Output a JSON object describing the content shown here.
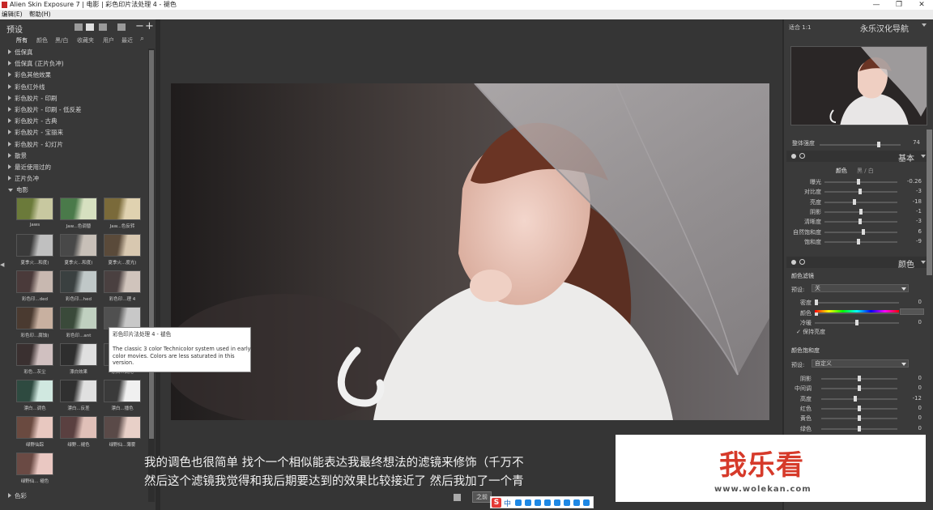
{
  "window": {
    "title": "Alien Skin Exposure 7 | 电影 | 彩色印片法处理 4 - 褪色",
    "min_glyph": "—",
    "restore_glyph": "❐",
    "close_glyph": "✕"
  },
  "menu": {
    "items": [
      "编辑(E)",
      "帮助(H)"
    ]
  },
  "presets_panel": {
    "title": "预设",
    "filters": [
      "所有",
      "颜色",
      "黑/白",
      "收藏夹",
      "用户",
      "最近"
    ],
    "categories": [
      {
        "label": "低保真",
        "open": false
      },
      {
        "label": "低保真 (正片负冲)",
        "open": false
      },
      {
        "label": "彩色其他效果",
        "open": false
      },
      {
        "label": "彩色红外线",
        "open": false
      },
      {
        "label": "彩色胶片 - 印刷",
        "open": false
      },
      {
        "label": "彩色胶片 - 印刷 - 低反差",
        "open": false
      },
      {
        "label": "彩色胶片 - 古典",
        "open": false
      },
      {
        "label": "彩色胶片 - 宝丽来",
        "open": false
      },
      {
        "label": "彩色胶片 - 幻灯片",
        "open": false
      },
      {
        "label": "散景",
        "open": false
      },
      {
        "label": "最近使用过的",
        "open": false
      },
      {
        "label": "正片负冲",
        "open": false
      },
      {
        "label": "电影",
        "open": true
      }
    ],
    "thumbnails": [
      "Jaws",
      "Jaw...色调替",
      "Jaw...色反转",
      "夏季火...和度)",
      "夏季火...和度)",
      "夏季火...度光)",
      "彩色印...ded",
      "彩色印...hed",
      "彩色印...理 4",
      "彩色印...腐蚀)",
      "彩色印...ant",
      "",
      "彩色...灰尘",
      "漂白效果",
      "漂白...高光",
      "漂白...调色",
      "漂白...反差",
      "漂白...播色",
      "绿野仙踪",
      "绿野...褪色",
      "绿野仙...薄雾",
      "绿野仙... 褪色"
    ],
    "bottom_category": "色彩"
  },
  "tooltip": {
    "title": "彩色印片法处理 4 - 褪色",
    "body": "The classic 3 color Technicolor system used in early color movies. Colors are less saturated in this version."
  },
  "navigator": {
    "fit": "适合",
    "ratio": "1:1",
    "title": "永乐汉化导航"
  },
  "overall_strength": {
    "label": "整体强度",
    "value": "74",
    "level": 0.74
  },
  "basic": {
    "title": "基本",
    "tab_color": "颜色",
    "tab_bw": "黑 / 白",
    "sliders": [
      {
        "label": "曝光",
        "value": "-0.26",
        "pos": 0.47
      },
      {
        "label": "对比度",
        "value": "-3",
        "pos": 0.49
      },
      {
        "label": "亮度",
        "value": "-18",
        "pos": 0.41
      },
      {
        "label": "阴影",
        "value": "-1",
        "pos": 0.5
      },
      {
        "label": "清晰度",
        "value": "-3",
        "pos": 0.49
      },
      {
        "label": "自然饱和度",
        "value": "6",
        "pos": 0.53
      },
      {
        "label": "饱和度",
        "value": "-9",
        "pos": 0.46
      }
    ]
  },
  "color": {
    "title": "颜色",
    "filter_section": "颜色滤镜",
    "preset_label": "预设:",
    "preset_value": "关",
    "sliders": [
      {
        "label": "密度",
        "value": "0",
        "pos": 0.0
      },
      {
        "label": "颜色",
        "value": "",
        "pos": 0.0
      },
      {
        "label": "冷暖",
        "value": "0",
        "pos": 0.5
      }
    ],
    "keep_brightness": "保持亮度",
    "sat_section": "颜色饱和度",
    "sat_preset_label": "预设:",
    "sat_preset_value": "自定义",
    "sat_sliders": [
      {
        "label": "阴影",
        "value": "0",
        "pos": 0.5
      },
      {
        "label": "中间调",
        "value": "0",
        "pos": 0.5
      },
      {
        "label": "高度",
        "value": "-12",
        "pos": 0.44
      },
      {
        "label": "红色",
        "value": "0",
        "pos": 0.5
      },
      {
        "label": "黄色",
        "value": "0",
        "pos": 0.5
      },
      {
        "label": "绿色",
        "value": "0",
        "pos": 0.5
      }
    ]
  },
  "subtitles": {
    "line1": "我的调色也很简单  找个一个相似能表达我最终想法的滤镜来修饰（千万不",
    "line2": "然后这个滤镜我觉得和我后期要达到的效果比较接近了  然后我加了一个青"
  },
  "watermark": {
    "text": "我乐看",
    "url": "www.wolekan.com"
  },
  "bottom_bar": {
    "before_label": "之前"
  },
  "ime": {
    "logo": "S",
    "mode": "中"
  }
}
